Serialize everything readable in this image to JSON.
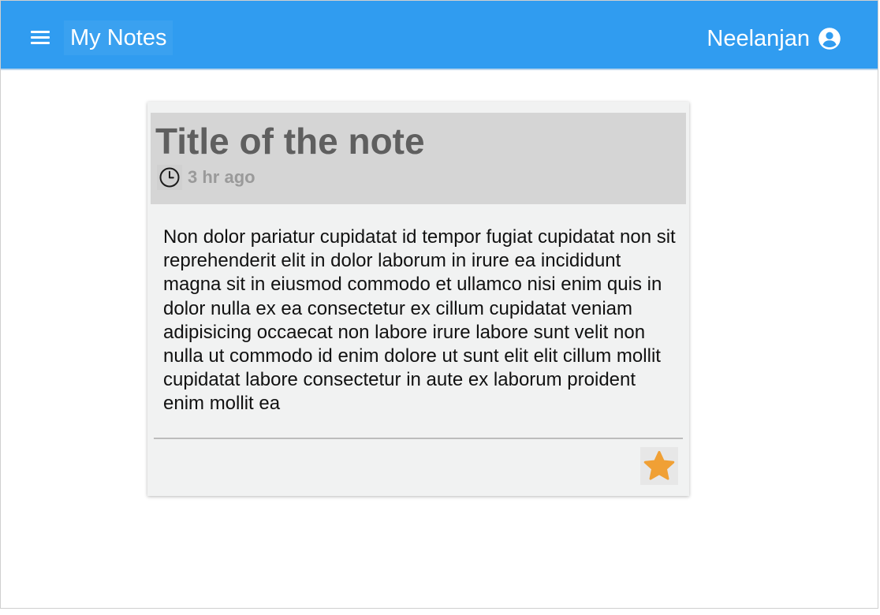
{
  "header": {
    "title": "My Notes",
    "user_name": "Neelanjan",
    "menu_icon": "hamburger-menu-icon",
    "account_icon": "account-circle-icon",
    "bar_color": "#309cf0"
  },
  "note": {
    "title": "Title of the note",
    "time": "3 hr ago",
    "time_icon": "clock-icon",
    "body": "Non dolor pariatur cupidatat id tempor fugiat cupidatat non sit reprehenderit elit in dolor laborum in irure ea incididunt magna sit in eiusmod commodo et ullamco nisi enim quis in dolor nulla ex ea consectetur ex cillum cupidatat veniam adipisicing occaecat non labore irure labore sunt velit non nulla ut commodo id enim dolore ut sunt elit elit cillum mollit cupidatat labore consectetur in aute ex laborum proident enim mollit ea",
    "favorite_icon": "star-icon",
    "favorite_color": "#f0a035",
    "card_color": "#f1f2f2",
    "header_color": "#d5d5d5"
  }
}
